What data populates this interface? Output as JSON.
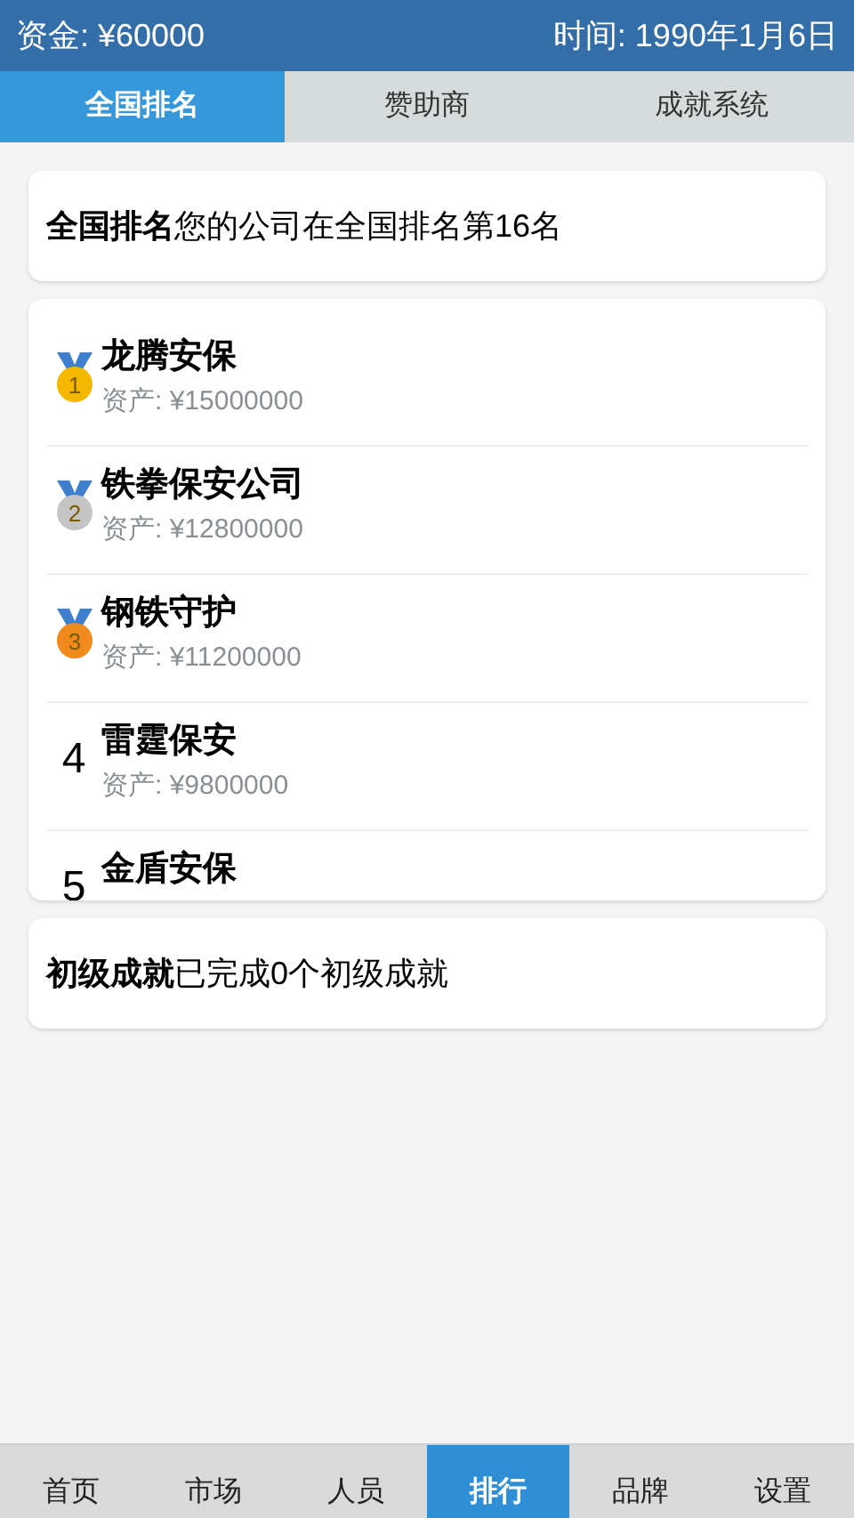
{
  "status_bar": {
    "funds": "资金: ¥60000",
    "time": "时间: 1990年1月6日"
  },
  "tabs": [
    {
      "label": "全国排名",
      "selected": true
    },
    {
      "label": "赞助商",
      "selected": false
    },
    {
      "label": "成就系统",
      "selected": false
    }
  ],
  "ranking_summary": {
    "title": "全国排名",
    "text": "您的公司在全国排名第16名"
  },
  "leaderboard": [
    {
      "kind": "medal",
      "rank": "1",
      "color": "#f5b800",
      "name": "龙腾安保",
      "assets": "资产: ¥15000000"
    },
    {
      "kind": "medal",
      "rank": "2",
      "color": "#c4c4c4",
      "name": "铁拳保安公司",
      "assets": "资产: ¥12800000"
    },
    {
      "kind": "medal",
      "rank": "3",
      "color": "#f08a1c",
      "name": "钢铁守护",
      "assets": "资产: ¥11200000"
    },
    {
      "kind": "number",
      "rank": "4",
      "name": "雷霆保安",
      "assets": "资产: ¥9800000"
    },
    {
      "kind": "number",
      "rank": "5",
      "name": "金盾安保"
    }
  ],
  "achievements": {
    "title": "初级成就",
    "text": "已完成0个初级成就"
  },
  "bottom_nav": [
    {
      "label": "首页",
      "selected": false
    },
    {
      "label": "市场",
      "selected": false
    },
    {
      "label": "人员",
      "selected": false
    },
    {
      "label": "排行",
      "selected": true
    },
    {
      "label": "品牌",
      "selected": false
    },
    {
      "label": "设置",
      "selected": false
    }
  ]
}
